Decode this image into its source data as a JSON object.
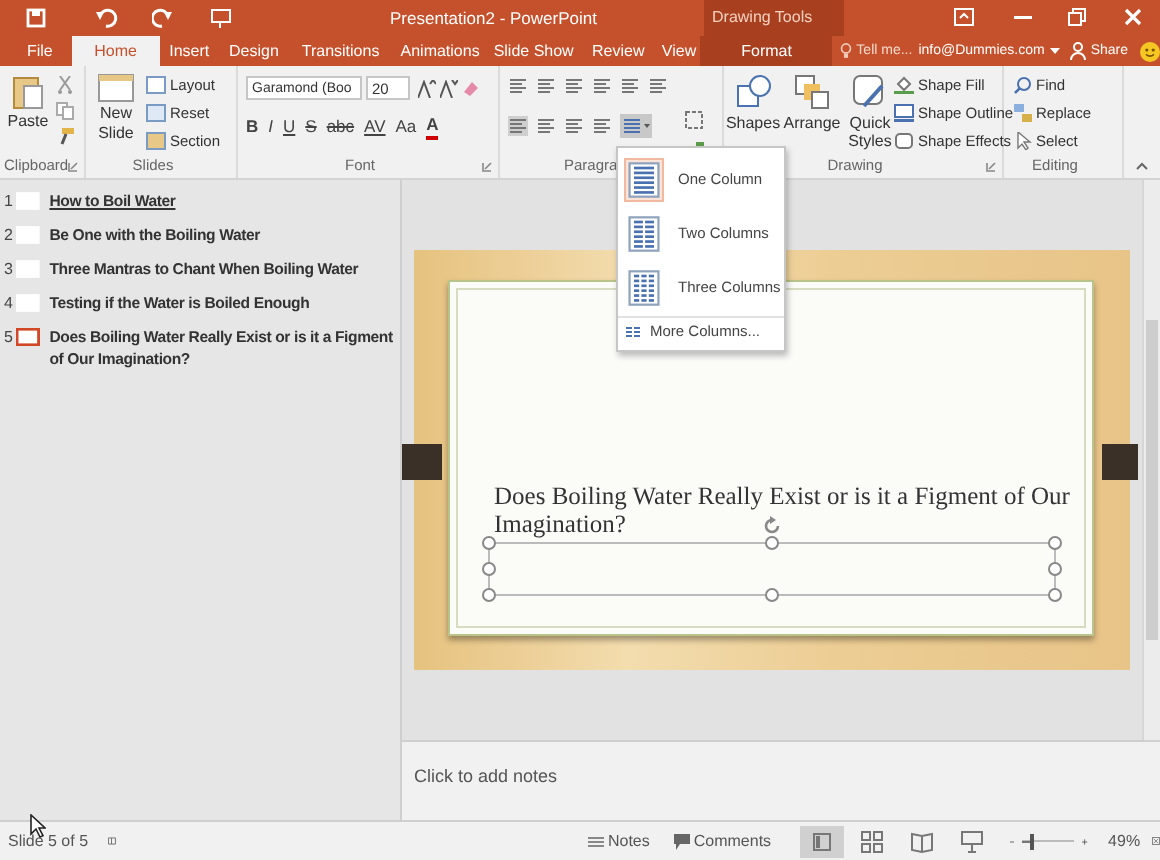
{
  "title_bar": {
    "title": "Presentation2 - PowerPoint",
    "contextual_title": "Drawing Tools"
  },
  "tabs": [
    {
      "label": "File",
      "selected": false,
      "contextual": false
    },
    {
      "label": "Home",
      "selected": true,
      "contextual": false
    },
    {
      "label": "Insert",
      "selected": false,
      "contextual": false
    },
    {
      "label": "Design",
      "selected": false,
      "contextual": false
    },
    {
      "label": "Transitions",
      "selected": false,
      "contextual": false
    },
    {
      "label": "Animations",
      "selected": false,
      "contextual": false
    },
    {
      "label": "Slide Show",
      "selected": false,
      "contextual": false
    },
    {
      "label": "Review",
      "selected": false,
      "contextual": false
    },
    {
      "label": "View",
      "selected": false,
      "contextual": false
    },
    {
      "label": "Format",
      "selected": false,
      "contextual": true
    }
  ],
  "tell_me": {
    "placeholder": "Tell me..."
  },
  "account": "info@Dummies.com",
  "share": "Share",
  "ribbon": {
    "clipboard": {
      "paste": "Paste",
      "label": "Clipboard"
    },
    "slides": {
      "new_slide": "New Slide",
      "layout": "Layout",
      "reset": "Reset",
      "section": "Section",
      "label": "Slides"
    },
    "font": {
      "font_name": "Garamond (Boo",
      "font_size": "20",
      "format_buttons": [
        "B",
        "I",
        "U",
        "S",
        "abc",
        "AV",
        "Aa",
        "A"
      ],
      "label": "Font"
    },
    "paragraph": {
      "label": "Paragra"
    },
    "drawing": {
      "shapes": "Shapes",
      "arrange": "Arrange",
      "quick_styles": "Quick Styles",
      "shape_fill": "Shape Fill",
      "shape_outline": "Shape Outline",
      "shape_effects": "Shape Effects",
      "label": "Drawing"
    },
    "editing": {
      "find": "Find",
      "replace": "Replace",
      "select": "Select",
      "label": "Editing"
    }
  },
  "outline": [
    {
      "number": "1",
      "title": "How to Boil Water",
      "selected": false,
      "underlined": true
    },
    {
      "number": "2",
      "title": "Be One with the Boiling Water",
      "selected": false,
      "underlined": false
    },
    {
      "number": "3",
      "title": "Three Mantras to Chant When Boiling Water",
      "selected": false,
      "underlined": false
    },
    {
      "number": "4",
      "title": "Testing if the Water is Boiled Enough",
      "selected": false,
      "underlined": false
    },
    {
      "number": "5",
      "title": "Does Boiling Water Really Exist or is it a Figment of Our Imagination?",
      "selected": true,
      "underlined": false
    }
  ],
  "columns_menu": [
    {
      "label": "One Column",
      "kind": "one",
      "selected": true
    },
    {
      "label": "Two Columns",
      "kind": "two",
      "selected": false
    },
    {
      "label": "Three Columns",
      "kind": "three",
      "selected": false
    },
    {
      "label": "More Columns...",
      "kind": "more",
      "selected": false
    }
  ],
  "slide": {
    "title": "Does Boiling Water Really Exist or is it a Figment of Our Imagination?"
  },
  "notes": {
    "placeholder": "Click to add notes"
  },
  "status_bar": {
    "slide_info": "Slide 5 of 5",
    "notes": "Notes",
    "comments": "Comments",
    "views": [
      {
        "selected": true
      },
      {
        "selected": false
      },
      {
        "selected": false
      },
      {
        "selected": false
      }
    ],
    "zoom_slider": {
      "level": 0.22
    },
    "zoom": "49%"
  }
}
